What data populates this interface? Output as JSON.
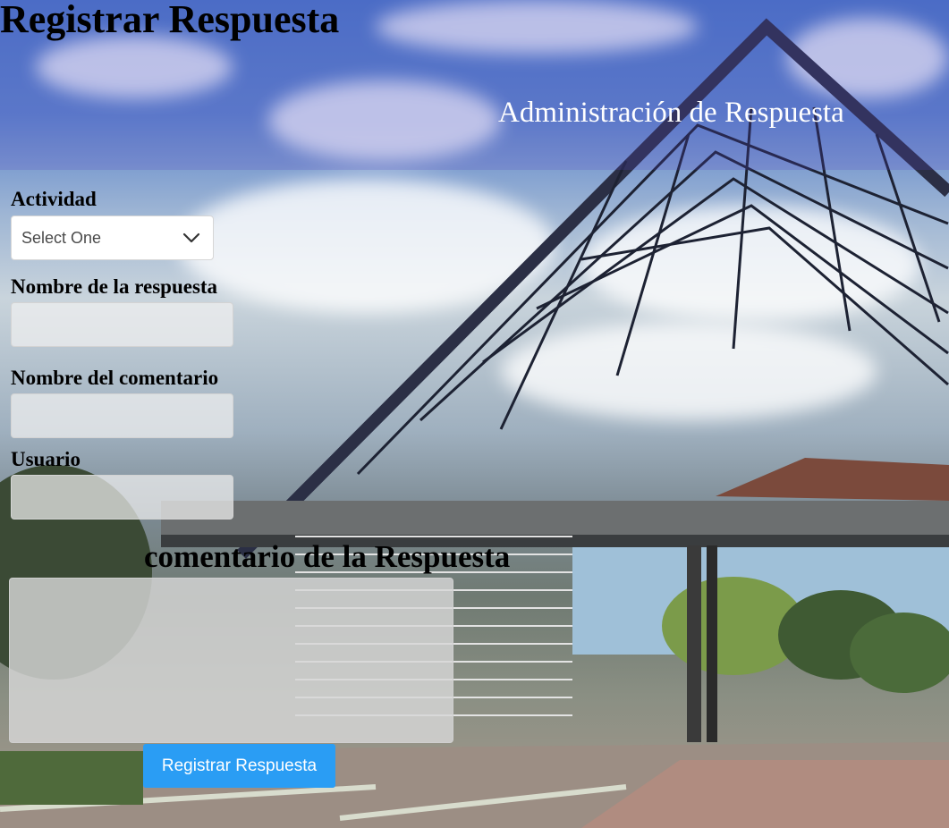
{
  "page": {
    "title": "Registrar Respuesta",
    "section_title": "Administración de Respuesta"
  },
  "form": {
    "actividad": {
      "label": "Actividad",
      "selected": "Select One"
    },
    "nombre_respuesta": {
      "label": "Nombre de la respuesta",
      "value": ""
    },
    "nombre_comentario": {
      "label": "Nombre del comentario",
      "value": ""
    },
    "usuario": {
      "label": "Usuario",
      "value": ""
    },
    "comentario": {
      "label": "comentario de la Respuesta",
      "value": ""
    },
    "submit_label": "Registrar Respuesta"
  },
  "colors": {
    "button": "#2a9df4",
    "button_text": "#ffffff",
    "header_text": "#ffffff"
  },
  "icons": {
    "select_arrow": "chevron-down-icon",
    "background": "campus-photo"
  }
}
